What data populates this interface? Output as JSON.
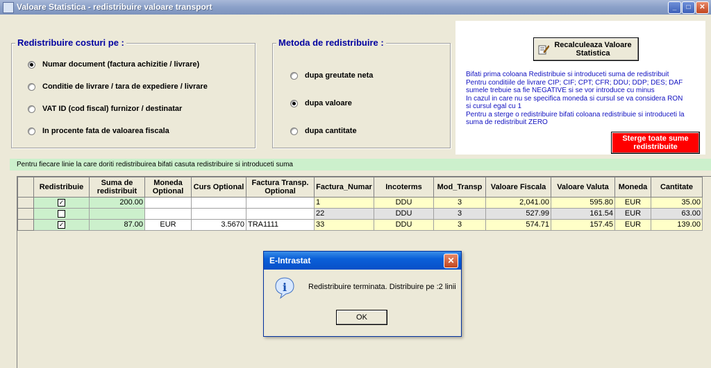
{
  "window": {
    "title": "Valoare Statistica - redistribuire valoare transport",
    "min_label": "_",
    "max_label": "□",
    "close_label": "✕"
  },
  "group_costs": {
    "title": "Redistribuire costuri pe  :",
    "options": [
      {
        "label": "Numar document (factura achizitie / livrare)",
        "selected": true
      },
      {
        "label": "Conditie de livrare / tara de expediere / livrare",
        "selected": false
      },
      {
        "label": "VAT ID (cod fiscal) furnizor / destinatar",
        "selected": false
      },
      {
        "label": "In procente fata de valoarea fiscala",
        "selected": false
      }
    ]
  },
  "group_method": {
    "title": "Metoda de redistribuire :",
    "options": [
      {
        "label": "dupa greutate neta",
        "selected": false
      },
      {
        "label": "dupa valoare",
        "selected": true
      },
      {
        "label": "dupa cantitate",
        "selected": false
      }
    ]
  },
  "info_panel": {
    "recalc_button": "Recalculeaza Valoare Statistica",
    "lines": [
      "Bifati prima coloana Redistribuie si introduceti suma de redistribuit",
      "Pentru conditiile de livrare CIP; CIF; CPT; CFR; DDU; DDP; DES; DAF",
      "sumele trebuie sa fie NEGATIVE si se vor introduce cu minus",
      "In cazul in care nu se specifica moneda si cursul se va considera RON",
      "si cursul egal cu 1",
      "Pentru a sterge o redistribuire bifati coloana redistribuie si introduceti la",
      "suma de redistribuit ZERO"
    ],
    "delete_button": "Sterge toate sume redistribuite"
  },
  "hint": "Pentru fiecare linie la care doriti redistribuirea bifati casuta redistribuire si introduceti suma",
  "table": {
    "columns": [
      "Redistribuie",
      "Suma de redistribuit",
      "Moneda Optional",
      "Curs Optional",
      "Factura Transp. Optional",
      "Factura_Numar",
      "Incoterms",
      "Mod_Transp",
      "Valoare Fiscala",
      "Valoare Valuta",
      "Moneda",
      "Cantitate"
    ],
    "rows": [
      {
        "checked": true,
        "suma": "200.00",
        "moneda_opt": "",
        "curs": "",
        "factura_transp": "",
        "factura_nr": "1",
        "incoterms": "DDU",
        "mod_transp": "3",
        "val_fiscala": "2,041.00",
        "val_valuta": "595.80",
        "moneda": "EUR",
        "cantitate": "35.00"
      },
      {
        "checked": false,
        "suma": "",
        "moneda_opt": "",
        "curs": "",
        "factura_transp": "",
        "factura_nr": "22",
        "incoterms": "DDU",
        "mod_transp": "3",
        "val_fiscala": "527.99",
        "val_valuta": "161.54",
        "moneda": "EUR",
        "cantitate": "63.00"
      },
      {
        "checked": true,
        "suma": "87.00",
        "moneda_opt": "EUR",
        "curs": "3.5670",
        "factura_transp": "TRA1111",
        "factura_nr": "33",
        "incoterms": "DDU",
        "mod_transp": "3",
        "val_fiscala": "574.71",
        "val_valuta": "157.45",
        "moneda": "EUR",
        "cantitate": "139.00"
      }
    ]
  },
  "dialog": {
    "title": "E-Intrastat",
    "message": "Redistribuire terminata. Distribuire pe :2 linii",
    "ok": "OK",
    "close": "✕",
    "icon_glyph": "i"
  }
}
